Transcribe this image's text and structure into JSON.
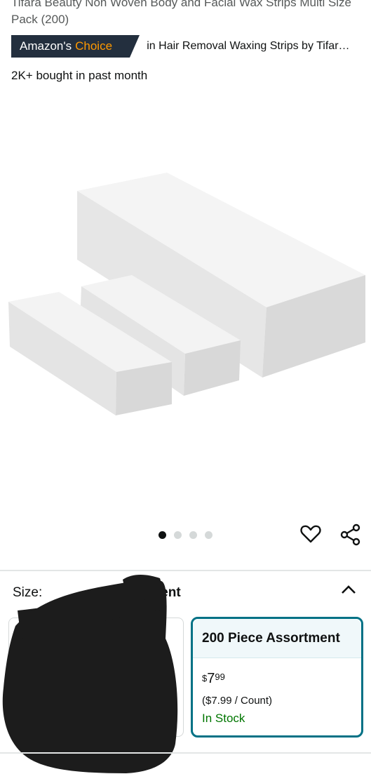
{
  "product": {
    "title": "Tifara Beauty Non Woven Body and Facial Wax Strips Multi Size Pack (200)",
    "badge_prefix": "Amazon's",
    "badge_highlight": "Choice",
    "badge_category": "in Hair Removal Waxing Strips by Tifar…",
    "bought_text": "2K+ bought in past month",
    "image_alt": "white non-woven wax strips stacks"
  },
  "carousel": {
    "total": 4,
    "active": 1
  },
  "icons": {
    "favorite": "heart-icon",
    "share": "share-icon",
    "collapse": "chevron-up-icon"
  },
  "size": {
    "label": "Size:",
    "value_visible": "ment"
  },
  "option": {
    "name": "200 Piece Assortment",
    "price_currency": "$",
    "price_whole": "7",
    "price_fraction": "99",
    "unit_price": "($7.99 / Count)",
    "availability": "In Stock"
  },
  "colors": {
    "accent": "#007185",
    "badge": "#232f3e",
    "badge_orange": "#ff9900",
    "in_stock": "#007600"
  }
}
